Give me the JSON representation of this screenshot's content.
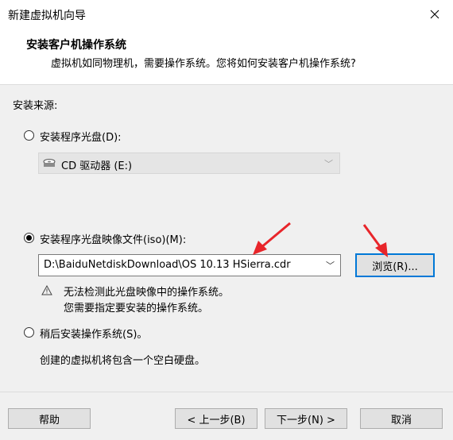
{
  "window": {
    "title": "新建虚拟机向导",
    "close_icon": "close-icon"
  },
  "header": {
    "title": "安装客户机操作系统",
    "subtitle": "虚拟机如同物理机，需要操作系统。您将如何安装客户机操作系统?"
  },
  "install_source": {
    "label": "安装来源:",
    "option_disc": {
      "label": "安装程序光盘(D):",
      "selected": false
    },
    "disc_drive": {
      "value": "CD 驱动器 (E:)",
      "icon": "disc-drive-icon",
      "enabled": false
    },
    "option_iso": {
      "label": "安装程序光盘映像文件(iso)(M):",
      "selected": true
    },
    "iso_path": {
      "value": "D:\\BaiduNetdiskDownload\\OS 10.13 HSierra.cdr"
    },
    "browse_label": "浏览(R)...",
    "warning": {
      "icon": "warning-icon",
      "line1": "无法检测此光盘映像中的操作系统。",
      "line2": "您需要指定要安装的操作系统。"
    },
    "option_later": {
      "label": "稍后安装操作系统(S)。",
      "selected": false
    },
    "later_desc": "创建的虚拟机将包含一个空白硬盘。"
  },
  "footer": {
    "help_label": "帮助",
    "back_label": "< 上一步(B)",
    "next_label": "下一步(N) >",
    "cancel_label": "取消"
  },
  "annotation_color": "#e8252a"
}
